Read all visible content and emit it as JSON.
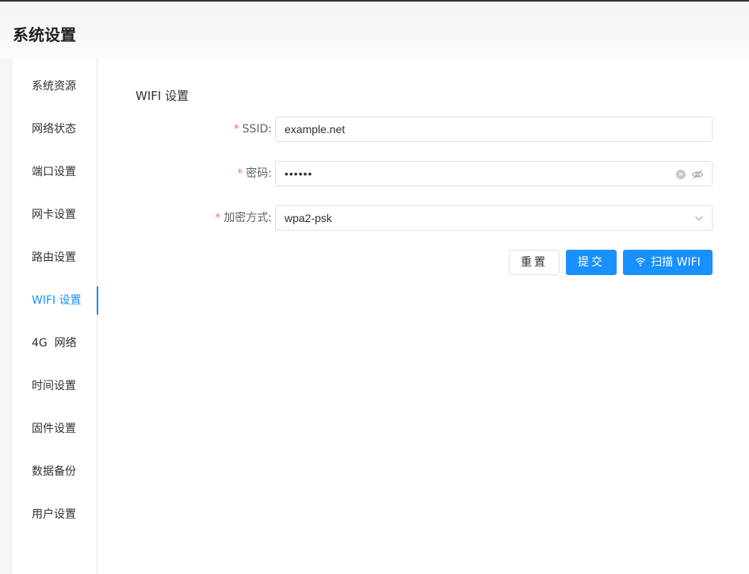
{
  "page": {
    "title": "系统设置"
  },
  "sidebar": {
    "items": [
      {
        "label": "系统资源",
        "active": false
      },
      {
        "label": "网络状态",
        "active": false
      },
      {
        "label": "端口设置",
        "active": false
      },
      {
        "label": "网卡设置",
        "active": false
      },
      {
        "label": "路由设置",
        "active": false
      },
      {
        "label": "WIFI 设置",
        "active": true
      },
      {
        "label": "4G  网络",
        "active": false
      },
      {
        "label": "时间设置",
        "active": false
      },
      {
        "label": "固件设置",
        "active": false
      },
      {
        "label": "数据备份",
        "active": false
      },
      {
        "label": "用户设置",
        "active": false
      }
    ]
  },
  "form": {
    "section_title": "WIFI 设置",
    "required_mark": "*",
    "ssid": {
      "label": "SSID:",
      "value": "example.net"
    },
    "password": {
      "label": "密码:",
      "value": "••••••",
      "icons": [
        "clear-icon",
        "eye-hidden-icon"
      ]
    },
    "encryption": {
      "label": "加密方式:",
      "value": "wpa2-psk",
      "icon": "chevron-down-icon"
    },
    "buttons": {
      "reset": "重置",
      "submit": "提交",
      "scan": "扫描 WIFI",
      "scan_icon": "wifi-icon"
    }
  },
  "colors": {
    "primary": "#1890ff",
    "required": "#f56c6c",
    "border": "#dcdfe6"
  }
}
